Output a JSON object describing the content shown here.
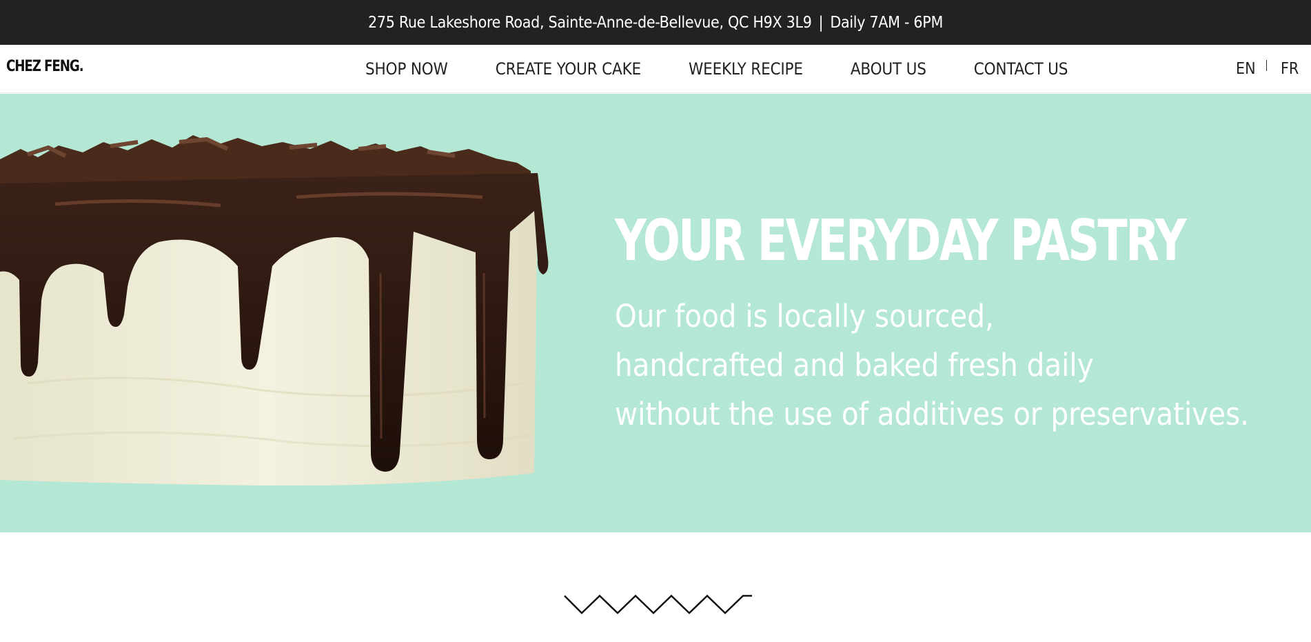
{
  "topbar": {
    "address": "275 Rue Lakeshore Road, Sainte-Anne-de-Bellevue, QC H9X 3L9",
    "separator": "|",
    "hours": "Daily 7AM - 6PM"
  },
  "header": {
    "logo": "CHEZ FENG.",
    "nav": [
      "SHOP NOW",
      "CREATE YOUR CAKE",
      "WEEKLY RECIPE",
      "ABOUT US",
      "CONTACT US"
    ],
    "languages": [
      "EN",
      "FR"
    ]
  },
  "hero": {
    "heading": "YOUR EVERYDAY PASTRY",
    "lines": [
      "Our food is locally sourced,",
      "handcrafted and baked fresh daily",
      "without the use of additives or preservatives."
    ],
    "background_color": "#b4e8d5",
    "image": "chocolate-drip-cake-image"
  },
  "divider": {
    "icon": "zigzag-icon"
  }
}
